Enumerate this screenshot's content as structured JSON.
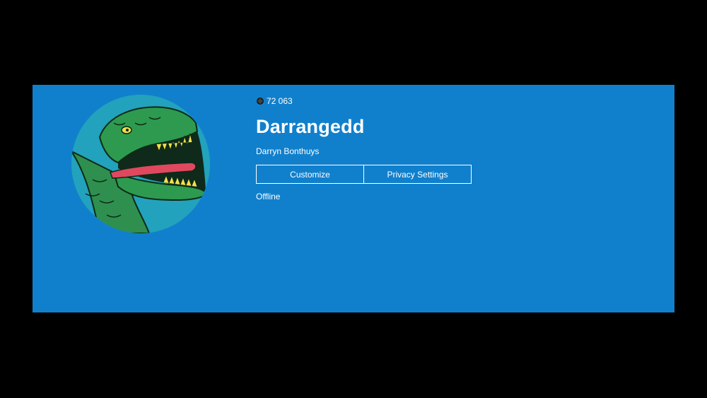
{
  "profile": {
    "gamerscore": "72 063",
    "gamerscore_icon": "gamerscore-icon",
    "gamertag": "Darrangedd",
    "real_name": "Darryn Bonthuys",
    "status": "Offline",
    "avatar": "t-rex-avatar"
  },
  "actions": {
    "customize_label": "Customize",
    "privacy_label": "Privacy Settings"
  },
  "colors": {
    "background": "#000000",
    "card": "#1180cc",
    "avatar_bg": "#22a2bd",
    "text": "#ffffff"
  }
}
